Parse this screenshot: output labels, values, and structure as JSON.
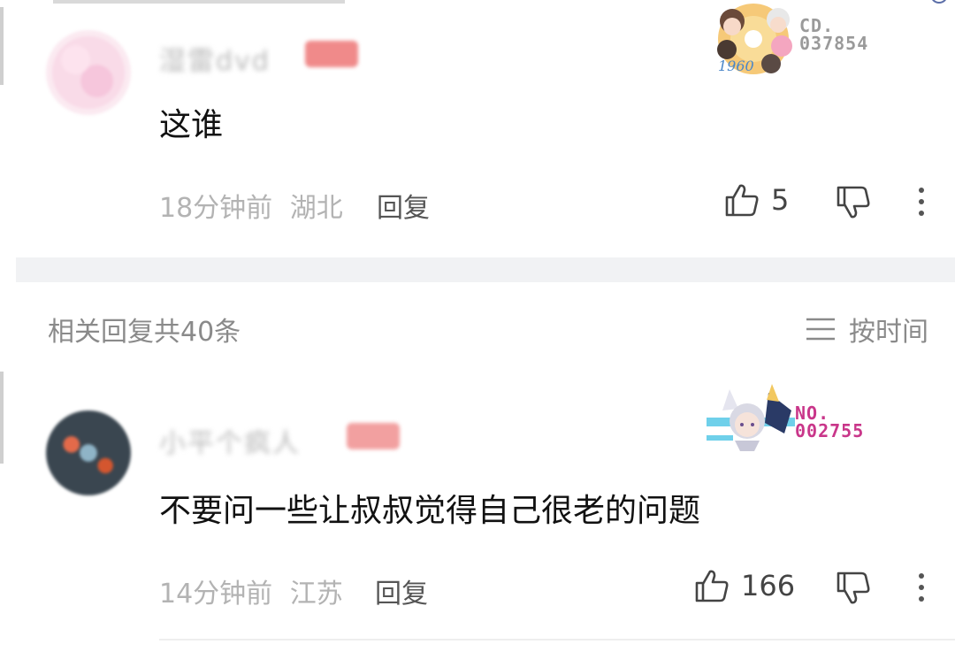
{
  "comments": [
    {
      "username": "湿雷dvd",
      "content": "这谁",
      "time": "18分钟前",
      "location": "湖北",
      "reply_label": "回复",
      "like_count": "5",
      "fan_label_top": "CD.",
      "fan_number": "037854"
    },
    {
      "username": "小平个疯人",
      "content": "不要问一些让叔叔觉得自己很老的问题",
      "time": "14分钟前",
      "location": "江苏",
      "reply_label": "回复",
      "like_count": "166",
      "fan_label_top": "NO.",
      "fan_number": "002755"
    }
  ],
  "replies_section": {
    "count_label": "相关回复共40条",
    "sort_label": "按时间"
  },
  "icons": {
    "like": "thumbs-up-icon",
    "dislike": "thumbs-down-icon",
    "more": "more-vertical-icon",
    "sort": "menu-lines-icon"
  },
  "colors": {
    "fan_text_gray": "#9a9a9a",
    "fan_text_magenta": "#c9368a",
    "meta_gray": "#b3b3b3",
    "divider": "#f1f2f4"
  }
}
